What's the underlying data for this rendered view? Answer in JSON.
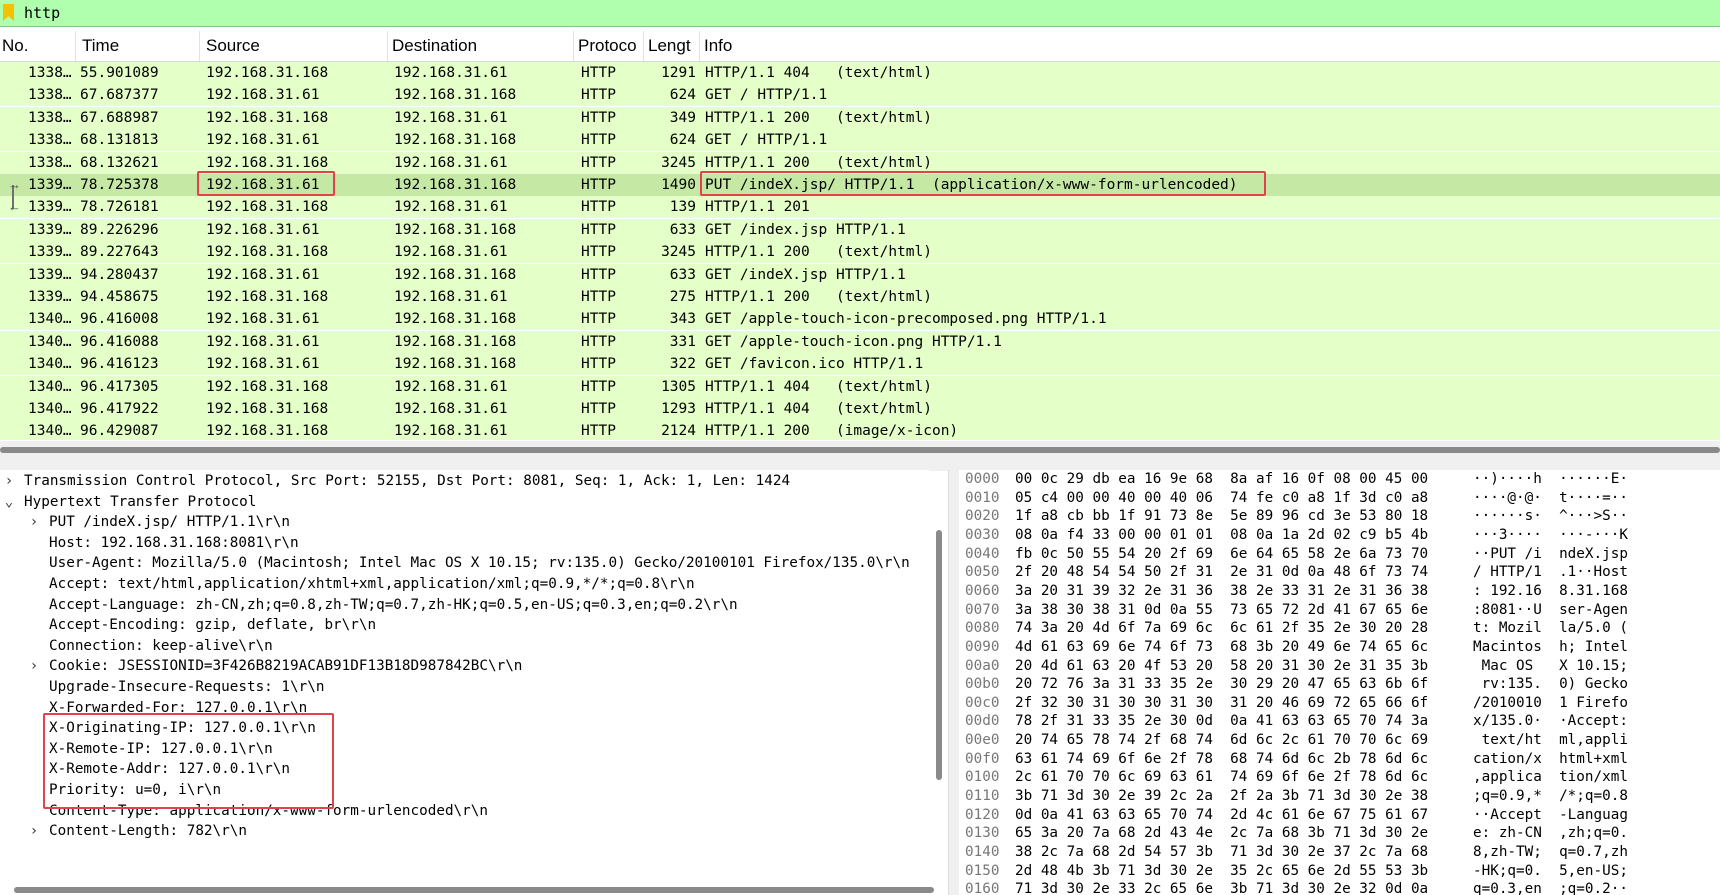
{
  "filter": {
    "value": "http"
  },
  "columns": [
    "No.",
    "Time",
    "Source",
    "Destination",
    "Protoco",
    "Lengt",
    "Info"
  ],
  "packets": [
    {
      "no": "1338…",
      "time": "55.901089",
      "src": "192.168.31.168",
      "dst": "192.168.31.61",
      "proto": "HTTP",
      "len": "1291",
      "info": "HTTP/1.1 404   (text/html)"
    },
    {
      "no": "1338…",
      "time": "67.687377",
      "src": "192.168.31.61",
      "dst": "192.168.31.168",
      "proto": "HTTP",
      "len": "624",
      "info": "GET / HTTP/1.1"
    },
    {
      "no": "1338…",
      "time": "67.688987",
      "src": "192.168.31.168",
      "dst": "192.168.31.61",
      "proto": "HTTP",
      "len": "349",
      "info": "HTTP/1.1 200   (text/html)"
    },
    {
      "no": "1338…",
      "time": "68.131813",
      "src": "192.168.31.61",
      "dst": "192.168.31.168",
      "proto": "HTTP",
      "len": "624",
      "info": "GET / HTTP/1.1"
    },
    {
      "no": "1338…",
      "time": "68.132621",
      "src": "192.168.31.168",
      "dst": "192.168.31.61",
      "proto": "HTTP",
      "len": "3245",
      "info": "HTTP/1.1 200   (text/html)"
    },
    {
      "no": "1339…",
      "time": "78.725378",
      "src": "192.168.31.61",
      "dst": "192.168.31.168",
      "proto": "HTTP",
      "len": "1490",
      "info": "PUT /indeX.jsp/ HTTP/1.1  (application/x-www-form-urlencoded)"
    },
    {
      "no": "1339…",
      "time": "78.726181",
      "src": "192.168.31.168",
      "dst": "192.168.31.61",
      "proto": "HTTP",
      "len": "139",
      "info": "HTTP/1.1 201"
    },
    {
      "no": "1339…",
      "time": "89.226296",
      "src": "192.168.31.61",
      "dst": "192.168.31.168",
      "proto": "HTTP",
      "len": "633",
      "info": "GET /index.jsp HTTP/1.1"
    },
    {
      "no": "1339…",
      "time": "89.227643",
      "src": "192.168.31.168",
      "dst": "192.168.31.61",
      "proto": "HTTP",
      "len": "3245",
      "info": "HTTP/1.1 200   (text/html)"
    },
    {
      "no": "1339…",
      "time": "94.280437",
      "src": "192.168.31.61",
      "dst": "192.168.31.168",
      "proto": "HTTP",
      "len": "633",
      "info": "GET /indeX.jsp HTTP/1.1"
    },
    {
      "no": "1339…",
      "time": "94.458675",
      "src": "192.168.31.168",
      "dst": "192.168.31.61",
      "proto": "HTTP",
      "len": "275",
      "info": "HTTP/1.1 200   (text/html)"
    },
    {
      "no": "1340…",
      "time": "96.416008",
      "src": "192.168.31.61",
      "dst": "192.168.31.168",
      "proto": "HTTP",
      "len": "343",
      "info": "GET /apple-touch-icon-precomposed.png HTTP/1.1"
    },
    {
      "no": "1340…",
      "time": "96.416088",
      "src": "192.168.31.61",
      "dst": "192.168.31.168",
      "proto": "HTTP",
      "len": "331",
      "info": "GET /apple-touch-icon.png HTTP/1.1"
    },
    {
      "no": "1340…",
      "time": "96.416123",
      "src": "192.168.31.61",
      "dst": "192.168.31.168",
      "proto": "HTTP",
      "len": "322",
      "info": "GET /favicon.ico HTTP/1.1"
    },
    {
      "no": "1340…",
      "time": "96.417305",
      "src": "192.168.31.168",
      "dst": "192.168.31.61",
      "proto": "HTTP",
      "len": "1305",
      "info": "HTTP/1.1 404   (text/html)"
    },
    {
      "no": "1340…",
      "time": "96.417922",
      "src": "192.168.31.168",
      "dst": "192.168.31.61",
      "proto": "HTTP",
      "len": "1293",
      "info": "HTTP/1.1 404   (text/html)"
    },
    {
      "no": "1340…",
      "time": "96.429087",
      "src": "192.168.31.168",
      "dst": "192.168.31.61",
      "proto": "HTTP",
      "len": "2124",
      "info": "HTTP/1.1 200   (image/x-icon)"
    }
  ],
  "selected_index": 5,
  "details": [
    {
      "arrow": "collapsed",
      "indent": 0,
      "text": "Transmission Control Protocol, Src Port: 52155, Dst Port: 8081, Seq: 1, Ack: 1, Len: 1424"
    },
    {
      "arrow": "expanded",
      "indent": 0,
      "text": "Hypertext Transfer Protocol"
    },
    {
      "arrow": "collapsed",
      "indent": 1,
      "text": "PUT /indeX.jsp/ HTTP/1.1\\r\\n"
    },
    {
      "arrow": "none",
      "indent": 1,
      "text": "Host: 192.168.31.168:8081\\r\\n"
    },
    {
      "arrow": "none",
      "indent": 1,
      "text": "User-Agent: Mozilla/5.0 (Macintosh; Intel Mac OS X 10.15; rv:135.0) Gecko/20100101 Firefox/135.0\\r\\n"
    },
    {
      "arrow": "none",
      "indent": 1,
      "text": "Accept: text/html,application/xhtml+xml,application/xml;q=0.9,*/*;q=0.8\\r\\n"
    },
    {
      "arrow": "none",
      "indent": 1,
      "text": "Accept-Language: zh-CN,zh;q=0.8,zh-TW;q=0.7,zh-HK;q=0.5,en-US;q=0.3,en;q=0.2\\r\\n"
    },
    {
      "arrow": "none",
      "indent": 1,
      "text": "Accept-Encoding: gzip, deflate, br\\r\\n"
    },
    {
      "arrow": "none",
      "indent": 1,
      "text": "Connection: keep-alive\\r\\n"
    },
    {
      "arrow": "collapsed",
      "indent": 1,
      "text": "Cookie: JSESSIONID=3F426B8219ACAB91DF13B18D987842BC\\r\\n"
    },
    {
      "arrow": "none",
      "indent": 1,
      "text": "Upgrade-Insecure-Requests: 1\\r\\n"
    },
    {
      "arrow": "none",
      "indent": 1,
      "text": "X-Forwarded-For: 127.0.0.1\\r\\n"
    },
    {
      "arrow": "none",
      "indent": 1,
      "text": "X-Originating-IP: 127.0.0.1\\r\\n"
    },
    {
      "arrow": "none",
      "indent": 1,
      "text": "X-Remote-IP: 127.0.0.1\\r\\n"
    },
    {
      "arrow": "none",
      "indent": 1,
      "text": "X-Remote-Addr: 127.0.0.1\\r\\n"
    },
    {
      "arrow": "none",
      "indent": 1,
      "text": "Priority: u=0, i\\r\\n"
    },
    {
      "arrow": "none",
      "indent": 1,
      "text": "Content-Type: application/x-www-form-urlencoded\\r\\n"
    },
    {
      "arrow": "collapsed",
      "indent": 1,
      "text": "Content-Length: 782\\r\\n"
    }
  ],
  "bytes": [
    {
      "off": "0000",
      "hex": "00 0c 29 db ea 16 9e 68  8a af 16 0f 08 00 45 00",
      "ascii": "··)····h  ······E·"
    },
    {
      "off": "0010",
      "hex": "05 c4 00 00 40 00 40 06  74 fe c0 a8 1f 3d c0 a8",
      "ascii": "····@·@·  t····=··"
    },
    {
      "off": "0020",
      "hex": "1f a8 cb bb 1f 91 73 8e  5e 89 96 cd 3e 53 80 18",
      "ascii": "······s·  ^···>S··"
    },
    {
      "off": "0030",
      "hex": "08 0a f4 33 00 00 01 01  08 0a 1a 2d 02 c9 b5 4b",
      "ascii": "···3····  ···-···K"
    },
    {
      "off": "0040",
      "hex": "fb 0c 50 55 54 20 2f 69  6e 64 65 58 2e 6a 73 70",
      "ascii": "··PUT /i  ndeX.jsp"
    },
    {
      "off": "0050",
      "hex": "2f 20 48 54 54 50 2f 31  2e 31 0d 0a 48 6f 73 74",
      "ascii": "/ HTTP/1  .1··Host"
    },
    {
      "off": "0060",
      "hex": "3a 20 31 39 32 2e 31 36  38 2e 33 31 2e 31 36 38",
      "ascii": ": 192.16  8.31.168"
    },
    {
      "off": "0070",
      "hex": "3a 38 30 38 31 0d 0a 55  73 65 72 2d 41 67 65 6e",
      "ascii": ":8081··U  ser-Agen"
    },
    {
      "off": "0080",
      "hex": "74 3a 20 4d 6f 7a 69 6c  6c 61 2f 35 2e 30 20 28",
      "ascii": "t: Mozil  la/5.0 ("
    },
    {
      "off": "0090",
      "hex": "4d 61 63 69 6e 74 6f 73  68 3b 20 49 6e 74 65 6c",
      "ascii": "Macintos  h; Intel"
    },
    {
      "off": "00a0",
      "hex": "20 4d 61 63 20 4f 53 20  58 20 31 30 2e 31 35 3b",
      "ascii": " Mac OS   X 10.15;"
    },
    {
      "off": "00b0",
      "hex": "20 72 76 3a 31 33 35 2e  30 29 20 47 65 63 6b 6f",
      "ascii": " rv:135.  0) Gecko"
    },
    {
      "off": "00c0",
      "hex": "2f 32 30 31 30 30 31 30  31 20 46 69 72 65 66 6f",
      "ascii": "/2010010  1 Firefo"
    },
    {
      "off": "00d0",
      "hex": "78 2f 31 33 35 2e 30 0d  0a 41 63 63 65 70 74 3a",
      "ascii": "x/135.0·  ·Accept:"
    },
    {
      "off": "00e0",
      "hex": "20 74 65 78 74 2f 68 74  6d 6c 2c 61 70 70 6c 69",
      "ascii": " text/ht  ml,appli"
    },
    {
      "off": "00f0",
      "hex": "63 61 74 69 6f 6e 2f 78  68 74 6d 6c 2b 78 6d 6c",
      "ascii": "cation/x  html+xml"
    },
    {
      "off": "0100",
      "hex": "2c 61 70 70 6c 69 63 61  74 69 6f 6e 2f 78 6d 6c",
      "ascii": ",applica  tion/xml"
    },
    {
      "off": "0110",
      "hex": "3b 71 3d 30 2e 39 2c 2a  2f 2a 3b 71 3d 30 2e 38",
      "ascii": ";q=0.9,*  /*;q=0.8"
    },
    {
      "off": "0120",
      "hex": "0d 0a 41 63 63 65 70 74  2d 4c 61 6e 67 75 61 67",
      "ascii": "··Accept  -Languag"
    },
    {
      "off": "0130",
      "hex": "65 3a 20 7a 68 2d 43 4e  2c 7a 68 3b 71 3d 30 2e",
      "ascii": "e: zh-CN  ,zh;q=0."
    },
    {
      "off": "0140",
      "hex": "38 2c 7a 68 2d 54 57 3b  71 3d 30 2e 37 2c 7a 68",
      "ascii": "8,zh-TW;  q=0.7,zh"
    },
    {
      "off": "0150",
      "hex": "2d 48 4b 3b 71 3d 30 2e  35 2c 65 6e 2d 55 53 3b",
      "ascii": "-HK;q=0.  5,en-US;"
    },
    {
      "off": "0160",
      "hex": "71 3d 30 2e 33 2c 65 6e  3b 71 3d 30 2e 32 0d 0a",
      "ascii": "q=0.3,en  ;q=0.2··"
    }
  ]
}
